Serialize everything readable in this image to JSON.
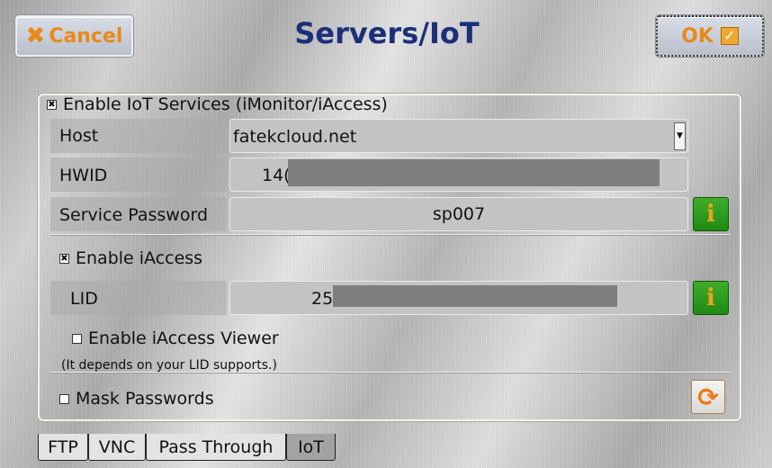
{
  "header": {
    "cancel_label": "Cancel",
    "title": "Servers/IoT",
    "ok_label": "OK"
  },
  "iot": {
    "enable_label": "Enable IoT Services (iMonitor/iAccess)",
    "enabled": true,
    "host_label": "Host",
    "host_value": "fatekcloud.net",
    "hwid_label": "HWID",
    "hwid_value": "14(",
    "service_password_label": "Service Password",
    "service_password_value": "sp007"
  },
  "iaccess": {
    "enable_label": "Enable iAccess",
    "enabled": true,
    "lid_label": "LID",
    "lid_value": "25",
    "viewer_label": "Enable iAccess Viewer",
    "viewer_enabled": false,
    "viewer_note": "(It depends on your LID supports.)"
  },
  "mask": {
    "label": "Mask Passwords",
    "enabled": false
  },
  "tabs": [
    {
      "label": "FTP",
      "active": false
    },
    {
      "label": "VNC",
      "active": false
    },
    {
      "label": "Pass Through",
      "active": false
    },
    {
      "label": "IoT",
      "active": true
    }
  ],
  "colors": {
    "title": "#1c2f7a",
    "accent_orange": "#e88a1a",
    "info_green": "#1f8a14"
  },
  "icons": {
    "cancel": "x-icon",
    "ok": "checkbox-checked-icon",
    "info": "info-icon",
    "refresh": "refresh-icon",
    "dropdown": "chevron-down-icon"
  }
}
